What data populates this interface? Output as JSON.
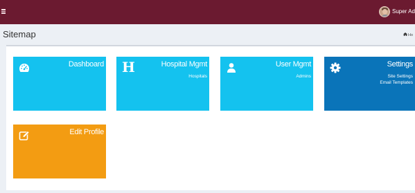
{
  "header": {
    "menu_icon": "hamburger-icon",
    "user": {
      "name": "Super Adm",
      "avatar": "user-avatar"
    }
  },
  "page": {
    "title": "Sitemap",
    "breadcrumb": {
      "icon": "home-icon",
      "label": "Ho"
    }
  },
  "tiles": [
    {
      "title": "Dashboard",
      "icon": "dashboard-icon",
      "color": "#14c2ef",
      "links": []
    },
    {
      "title": "Hospital Mgmt",
      "icon": "hospital-icon",
      "color": "#14c2ef",
      "links": [
        "Hospitals"
      ]
    },
    {
      "title": "User Mgmt",
      "icon": "user-icon",
      "color": "#14c2ef",
      "links": [
        "Admins"
      ]
    },
    {
      "title": "Settings",
      "icon": "gear-icon",
      "color": "#0a74b9",
      "links": [
        "Site Settings",
        "Email Templates"
      ]
    },
    {
      "title": "Edit Profile",
      "icon": "edit-icon",
      "color": "#f39c12",
      "links": []
    }
  ],
  "colors": {
    "topbar": "#6b1a30",
    "background": "#ecf0f5"
  }
}
